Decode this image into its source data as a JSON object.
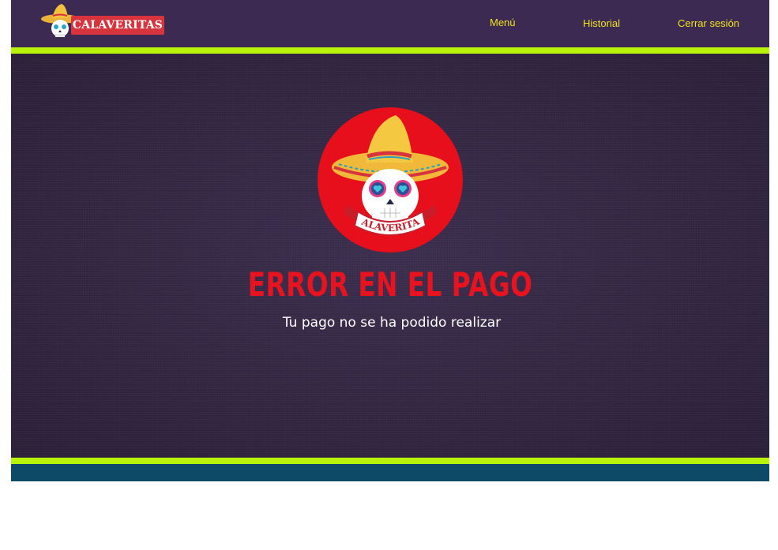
{
  "brand": {
    "name": "CALAVERITAS"
  },
  "nav": {
    "menu": "Menú",
    "history": "Historial",
    "logout": "Cerrar sesión"
  },
  "badge": {
    "text": "CALAVERITAS"
  },
  "error": {
    "title": "ERROR EN EL PAGO",
    "message": "Tu pago no se ha podido realizar"
  },
  "colors": {
    "header_bg": "#3c2a52",
    "accent_stripe": "#b9f20a",
    "nav_text": "#f2e31c",
    "error_title": "#e8131f",
    "badge_red": "#e60f1b",
    "footer_bg": "#0c4a68"
  }
}
